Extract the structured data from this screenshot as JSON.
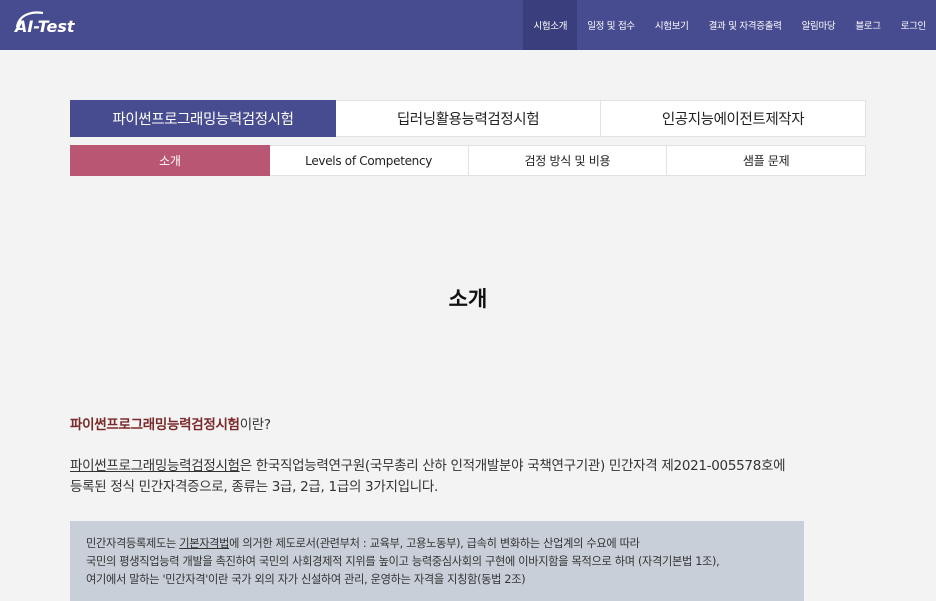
{
  "header": {
    "logo_text": "AI-Test",
    "nav": [
      {
        "label": "시험소개",
        "active": true
      },
      {
        "label": "일정 및 접수",
        "active": false
      },
      {
        "label": "시험보기",
        "active": false
      },
      {
        "label": "결과 및 자격증출력",
        "active": false
      },
      {
        "label": "알림마당",
        "active": false
      },
      {
        "label": "블로그",
        "active": false
      },
      {
        "label": "로그인",
        "active": false
      }
    ]
  },
  "exam_tabs": [
    {
      "label": "파이썬프로그래밍능력검정시험",
      "active": true
    },
    {
      "label": "딥러닝활용능력검정시험",
      "active": false
    },
    {
      "label": "인공지능에이전트제작자",
      "active": false
    }
  ],
  "sub_tabs": [
    {
      "label": "소개",
      "active": true
    },
    {
      "label": "Levels of Competency",
      "active": false
    },
    {
      "label": "검정 방식 및 비용",
      "active": false
    },
    {
      "label": "샘플 문제",
      "active": false
    }
  ],
  "content": {
    "page_title": "소개",
    "question_accent": "파이썬프로그래밍능력검정시험",
    "question_rest": "이란?",
    "para_link": "파이썬프로그래밍능력검정시험",
    "para_line1_rest": "은 한국직업능력연구원(국무총리 산하 인적개발분야 국책연구기관) 민간자격 제2021-005578호에",
    "para_line2": "등록된 정식 민간자격증으로, 종류는 3급, 2급, 1급의 3가지입니다.",
    "notice_prefix": "민간자격등록제도는 ",
    "notice_link": "기본자격법",
    "notice_line1_rest": "에 의거한 제도로서(관련부처 : 교육부, 고용노동부), 급속히 변화하는 산업계의 수요에 따라",
    "notice_line2": "국민의 평생직업능력 개발을 촉진하여 국민의 사회경제적 지위를 높이고 능력중심사회의 구현에 이바지함을 목적으로 하며 (자격기본법 1조),",
    "notice_line3": "여기에서 말하는 '민간자격'이란 국가 외의 자가 신설하여 관리, 운영하는 자격을 지칭함(동법 2조)"
  },
  "colors": {
    "header_bg": "#474b8f",
    "tab_active": "#474b8f",
    "subtab_active": "#b95674",
    "accent_text": "#7a2a2a",
    "notice_bg": "#c9cfd9"
  }
}
